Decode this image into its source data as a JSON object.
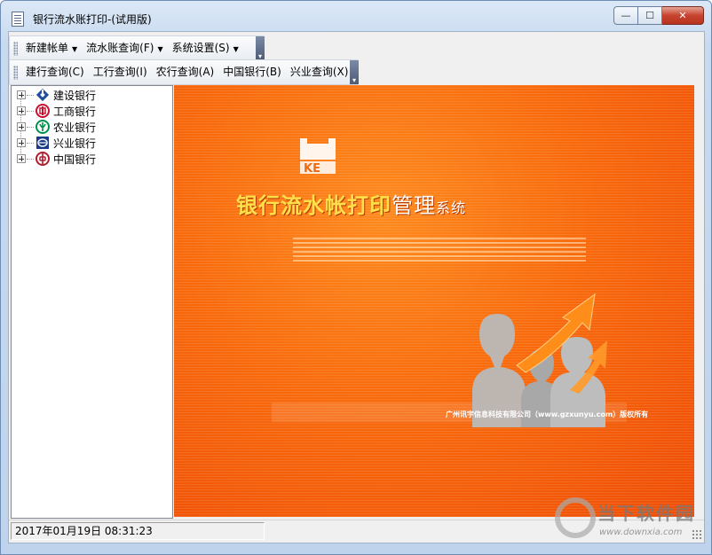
{
  "window": {
    "title": "银行流水账打印-(试用版)",
    "controls": {
      "minimize": "—",
      "maximize": "☐",
      "close": "✕"
    }
  },
  "toolbar1": {
    "items": [
      {
        "label": "新建帐单",
        "dropdown": true
      },
      {
        "label": "流水账查询(F)",
        "dropdown": true
      },
      {
        "label": "系统设置(S)",
        "dropdown": true
      }
    ],
    "overflow": "▾"
  },
  "toolbar2": {
    "items": [
      {
        "label": "建行查询(C)"
      },
      {
        "label": "工行查询(I)"
      },
      {
        "label": "农行查询(A)"
      },
      {
        "label": "中国银行(B)"
      },
      {
        "label": "兴业查询(X)"
      }
    ],
    "overflow": "▾"
  },
  "tree": {
    "nodes": [
      {
        "label": "建设银行",
        "icon": "ccb-logo-icon",
        "color": "#1f4e9a"
      },
      {
        "label": "工商银行",
        "icon": "icbc-logo-icon",
        "color": "#c8102e"
      },
      {
        "label": "农业银行",
        "icon": "abc-logo-icon",
        "color": "#00924c"
      },
      {
        "label": "兴业银行",
        "icon": "cib-logo-icon",
        "color": "#1a3a8a"
      },
      {
        "label": "中国银行",
        "icon": "boc-logo-icon",
        "color": "#b01c2e"
      }
    ]
  },
  "banner": {
    "logo_text": "KE",
    "title_main": "银行流水帐打印",
    "title_mid": "管理",
    "title_small": "系统",
    "copyright": "广州讯宇信息科技有限公司（www.gzxunyu.com）版权所有",
    "colors": {
      "primary": "#f86a0c",
      "accent": "#ffe04a"
    }
  },
  "status": {
    "datetime": "2017年01月19日 08:31:23"
  },
  "watermark": {
    "text": "当下软件园",
    "url": "www.downxia.com"
  }
}
